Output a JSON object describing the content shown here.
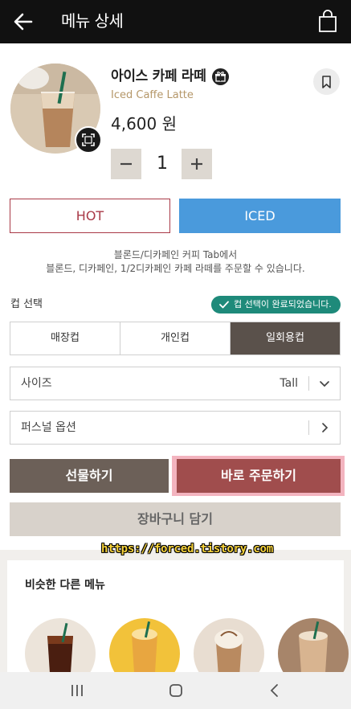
{
  "header": {
    "title": "메뉴 상세",
    "back_icon": "arrow-left-icon",
    "bag_icon": "shopping-bag-icon"
  },
  "product": {
    "name": "아이스 카페 라떼",
    "english_name": "Iced Caffe Latte",
    "price": "4,600 원",
    "gift_icon": "gift-icon",
    "bookmark_icon": "bookmark-icon",
    "zoom_icon": "expand-icon"
  },
  "quantity": {
    "minus_label": "−",
    "value": "1",
    "plus_label": "+"
  },
  "temperature": {
    "hot_label": "HOT",
    "iced_label": "ICED",
    "selected": "ICED"
  },
  "notice": {
    "line1": "블론드/디카페인 커피 Tab에서",
    "line2": "블론드, 디카페인, 1/2디카페인 카페 라떼를 주문할 수 있습니다."
  },
  "cup": {
    "label": "컵 선택",
    "complete_badge": "컵 선택이 완료되었습니다.",
    "options": [
      "매장컵",
      "개인컵",
      "일회용컵"
    ],
    "selected": "일회용컵"
  },
  "size_option": {
    "label": "사이즈",
    "value": "Tall"
  },
  "personal_option": {
    "label": "퍼스널 옵션"
  },
  "actions": {
    "gift_label": "선물하기",
    "order_label": "바로 주문하기",
    "cart_label": "장바구니 담기"
  },
  "watermark": "https://forced.tistory.com",
  "similar": {
    "title": "비슷한 다른 메뉴"
  },
  "colors": {
    "iced_accent": "#4a9adc",
    "hot_accent": "#a93947",
    "order_button": "#a04d4d",
    "gift_button": "#6c6058",
    "badge_green": "#1e8a7a"
  }
}
